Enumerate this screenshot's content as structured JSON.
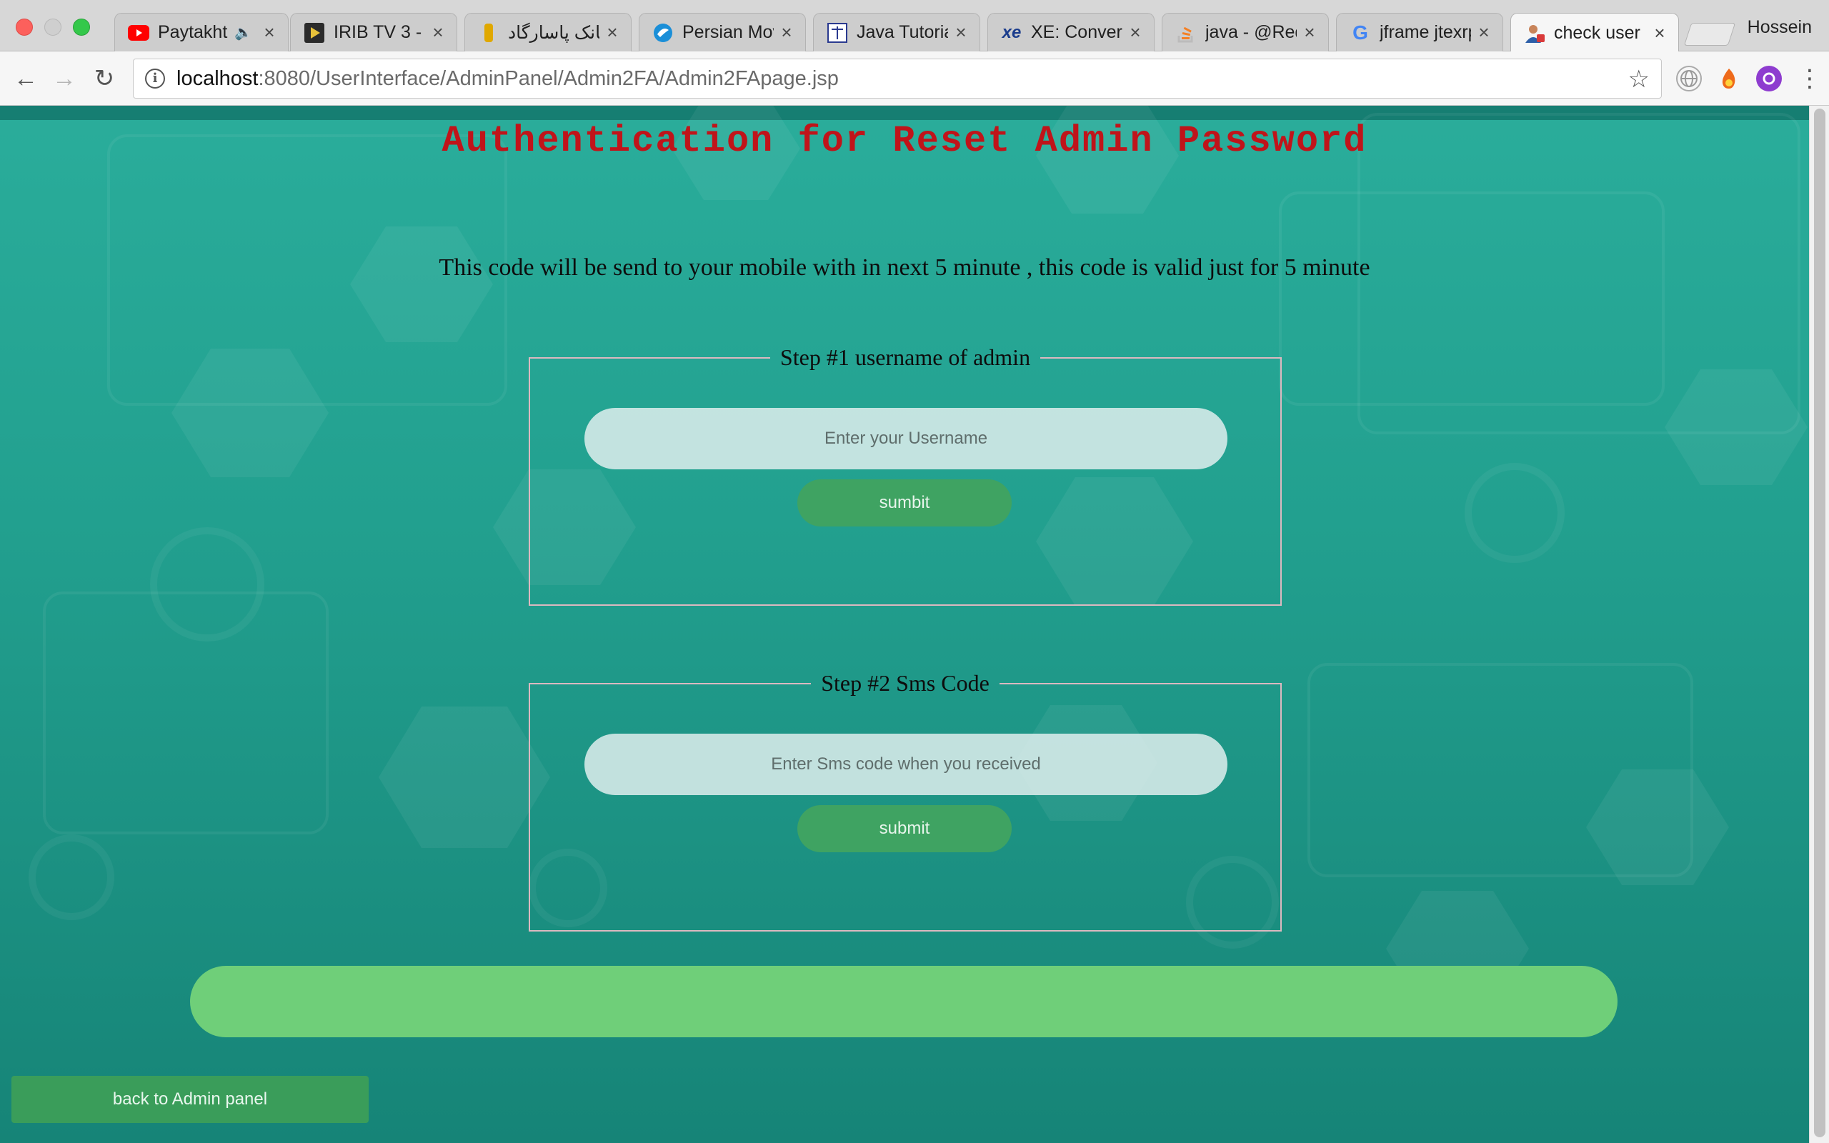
{
  "browser": {
    "tabs": [
      {
        "title": "Paytakht",
        "icon": "youtube-icon",
        "muted_indicator": "🔈"
      },
      {
        "title": "IRIB TV 3 - ·",
        "icon": "play-icon"
      },
      {
        "title": "بانک پاسارگاد ::",
        "icon": "pasargad-icon"
      },
      {
        "title": "Persian Mov",
        "icon": "bird-icon"
      },
      {
        "title": "Java Tutoria",
        "icon": "scales-icon"
      },
      {
        "title": "XE: Convert",
        "icon": "xe-icon"
      },
      {
        "title": "java - @Req",
        "icon": "stackoverflow-icon"
      },
      {
        "title": "jframe jtexrp",
        "icon": "google-icon"
      },
      {
        "title": "check user",
        "icon": "user-icon",
        "active": true
      }
    ],
    "profile_name": "Hossein",
    "url_host": "localhost",
    "url_rest": ":8080/UserInterface/AdminPanel/Admin2FA/Admin2FApage.jsp"
  },
  "page": {
    "heading": "Authentication for Reset Admin Password",
    "notice": "This code will be send to your mobile with in next 5 minute , this code is valid just for 5 minute",
    "step1": {
      "legend": "Step #1  username of admin",
      "placeholder": "Enter your Username",
      "button": "sumbit"
    },
    "step2": {
      "legend": "Step #2  Sms Code",
      "placeholder": "Enter Sms code when you received",
      "button": "submit"
    },
    "back_button": "back to Admin panel"
  },
  "colors": {
    "heading": "#c0141a",
    "page_bg_top": "#2aad9b",
    "page_bg_bottom": "#168477",
    "button_green": "#3fa362",
    "result_bar": "#6fcf79"
  }
}
